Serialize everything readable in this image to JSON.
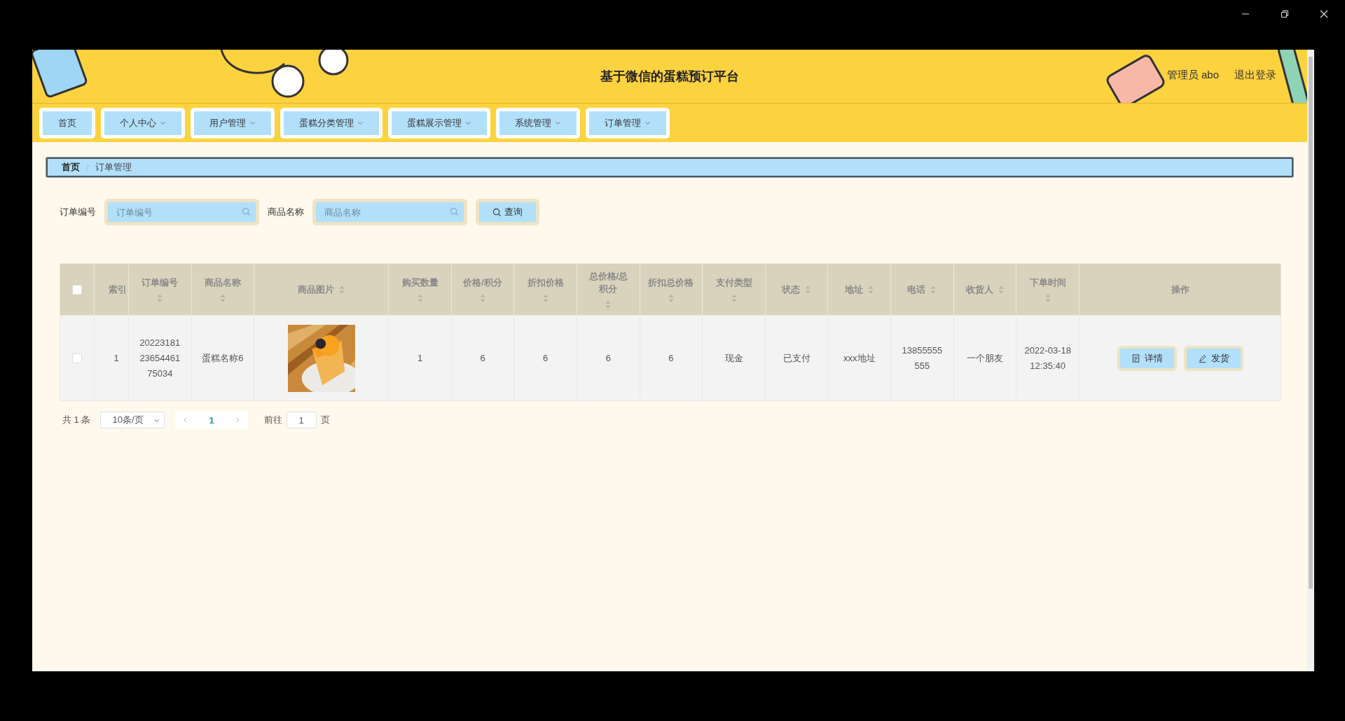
{
  "header": {
    "title": "基于微信的蛋糕预订平台",
    "user": "管理员 abo",
    "logout": "退出登录"
  },
  "nav": [
    {
      "label": "首页",
      "dropdown": false
    },
    {
      "label": "个人中心",
      "dropdown": true
    },
    {
      "label": "用户管理",
      "dropdown": true
    },
    {
      "label": "蛋糕分类管理",
      "dropdown": true
    },
    {
      "label": "蛋糕展示管理",
      "dropdown": true
    },
    {
      "label": "系统管理",
      "dropdown": true
    },
    {
      "label": "订单管理",
      "dropdown": true
    }
  ],
  "breadcrumb": {
    "separator": "/",
    "items": [
      {
        "label": "首页",
        "link": true
      },
      {
        "label": "订单管理",
        "link": false
      }
    ]
  },
  "search": {
    "fields": [
      {
        "label": "订单编号",
        "placeholder": "订单编号"
      },
      {
        "label": "商品名称",
        "placeholder": "商品名称"
      }
    ],
    "button": "查询"
  },
  "table": {
    "columns": [
      {
        "kind": "checkbox",
        "checked": false
      },
      {
        "kind": "text",
        "label": "索引",
        "sortable": false
      },
      {
        "kind": "text",
        "label": "订单编号",
        "sortable": true
      },
      {
        "kind": "text",
        "label": "商品名称",
        "sortable": true
      },
      {
        "kind": "text",
        "label": "商品图片",
        "sortable": true
      },
      {
        "kind": "text",
        "label": "购买数量",
        "sortable": true
      },
      {
        "kind": "text",
        "label": "价格/积分",
        "sortable": true
      },
      {
        "kind": "text",
        "label": "折扣价格",
        "sortable": true
      },
      {
        "kind": "text",
        "label": "总价格/总积分",
        "sortable": true
      },
      {
        "kind": "text",
        "label": "折扣总价格",
        "sortable": true
      },
      {
        "kind": "text",
        "label": "支付类型",
        "sortable": true
      },
      {
        "kind": "text",
        "label": "状态",
        "sortable": true
      },
      {
        "kind": "text",
        "label": "地址",
        "sortable": true
      },
      {
        "kind": "text",
        "label": "电话",
        "sortable": true
      },
      {
        "kind": "text",
        "label": "收货人",
        "sortable": true
      },
      {
        "kind": "text",
        "label": "下单时间",
        "sortable": true
      },
      {
        "kind": "text",
        "label": "操作",
        "sortable": false
      }
    ],
    "rows": [
      {
        "cells": [
          {
            "kind": "checkbox",
            "checked": false
          },
          {
            "kind": "text",
            "text": "1"
          },
          {
            "kind": "text",
            "text": "202231812365446175034"
          },
          {
            "kind": "text",
            "text": "蛋糕名称6"
          },
          {
            "kind": "picture"
          },
          {
            "kind": "text",
            "text": "1"
          },
          {
            "kind": "text",
            "text": "6"
          },
          {
            "kind": "text",
            "text": "6"
          },
          {
            "kind": "text",
            "text": "6"
          },
          {
            "kind": "text",
            "text": "6"
          },
          {
            "kind": "text",
            "text": "现金"
          },
          {
            "kind": "text",
            "text": "已支付"
          },
          {
            "kind": "text",
            "text": "xxx地址"
          },
          {
            "kind": "text",
            "text": "13855555555"
          },
          {
            "kind": "text",
            "text": "一个朋友"
          },
          {
            "kind": "text",
            "text": "2022-03-18 12:35:40"
          },
          {
            "kind": "actions",
            "buttons": [
              {
                "label": "详情"
              },
              {
                "label": "发货"
              }
            ]
          }
        ]
      }
    ]
  },
  "pagination": {
    "total": "共 1 条",
    "page_size": "10条/页",
    "pages": [
      {
        "label": "1",
        "selected": true
      }
    ],
    "goto_label": "前往",
    "goto_value": "1",
    "page_unit": "页"
  }
}
